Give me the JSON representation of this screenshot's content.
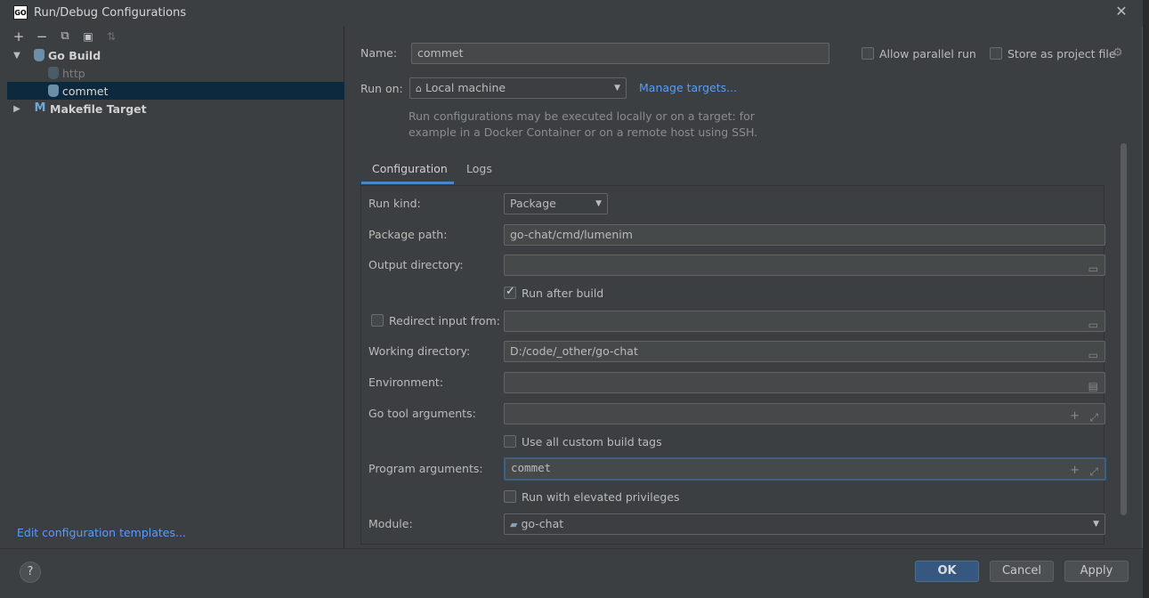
{
  "window": {
    "title": "Run/Debug Configurations",
    "icon_text": "GO"
  },
  "toolbar": {
    "add": "+",
    "remove": "−",
    "copy": "⧉",
    "folder": "▣",
    "sort": "⇅"
  },
  "tree": {
    "go_build": "Go Build",
    "http": "http",
    "commet": "commet",
    "makefile": "Makefile Target"
  },
  "left": {
    "edit_templates": "Edit configuration templates..."
  },
  "form": {
    "name_label": "Name:",
    "name_value": "commet",
    "allow_parallel": "Allow parallel run",
    "store_project": "Store as project file",
    "run_on_label": "Run on:",
    "run_on_value": "Local machine",
    "manage_targets": "Manage targets...",
    "hint": "Run configurations may be executed locally or on a target: for\nexample in a Docker Container or on a remote host using SSH.",
    "tab_configuration": "Configuration",
    "tab_logs": "Logs",
    "run_kind_label": "Run kind:",
    "run_kind_value": "Package",
    "package_path_label": "Package path:",
    "package_path_value": "go-chat/cmd/lumenim",
    "output_dir_label": "Output directory:",
    "output_dir_value": "",
    "run_after_build": "Run after build",
    "redirect_input": "Redirect input from:",
    "redirect_value": "",
    "working_dir_label": "Working directory:",
    "working_dir_value": "D:/code/_other/go-chat",
    "environment_label": "Environment:",
    "environment_value": "",
    "go_tool_args_label": "Go tool arguments:",
    "go_tool_args_value": "",
    "use_custom_tags": "Use all custom build tags",
    "program_args_label": "Program arguments:",
    "program_args_value": "commet",
    "elevated": "Run with elevated privileges",
    "module_label": "Module:",
    "module_value": "go-chat"
  },
  "footer": {
    "help": "?",
    "ok": "OK",
    "cancel": "Cancel",
    "apply": "Apply"
  }
}
